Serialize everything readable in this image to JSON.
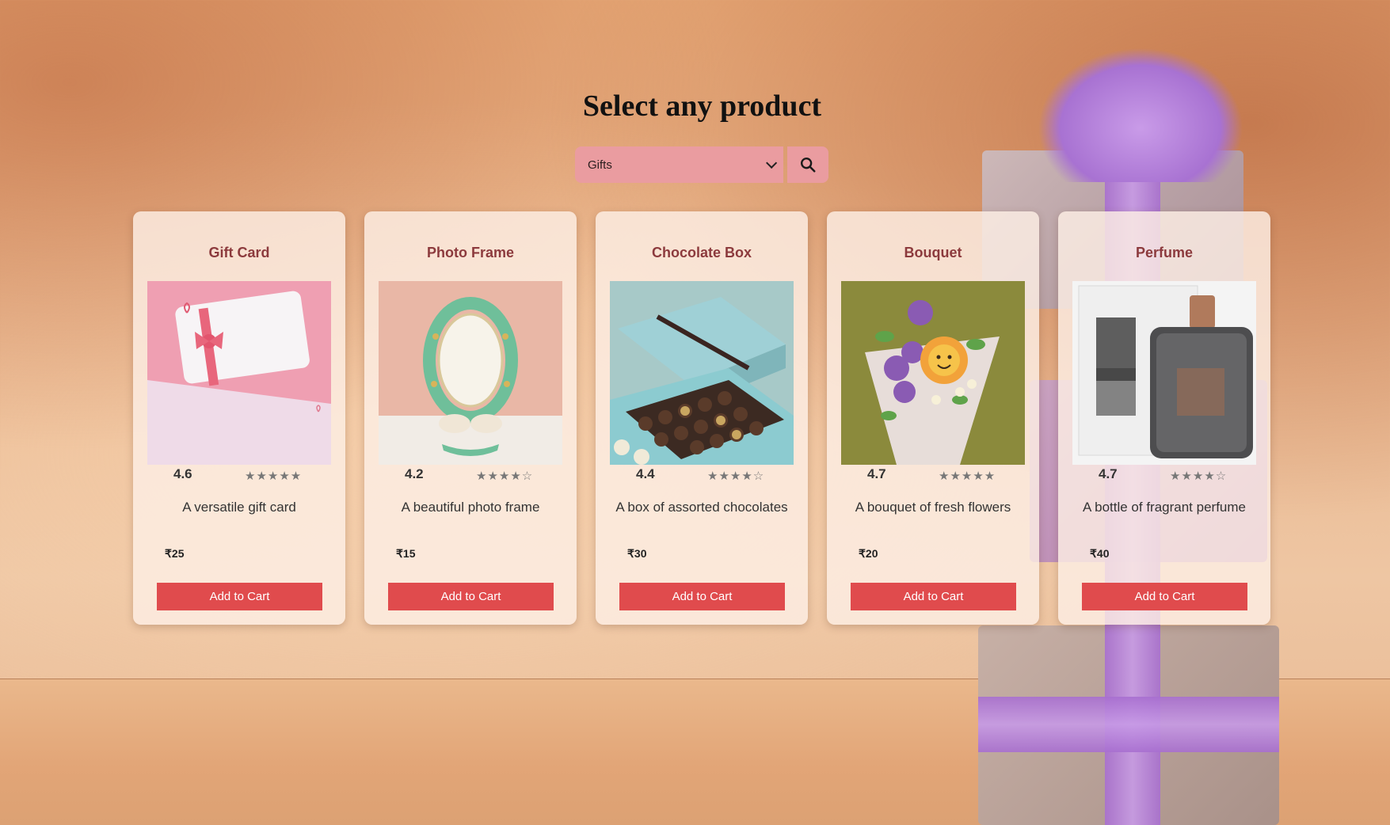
{
  "page": {
    "title": "Select any product"
  },
  "search": {
    "selected_category": "Gifts"
  },
  "colors": {
    "button": "#e04b4d",
    "name_text": "#8c3a3d",
    "select_bg": "#ea9ca0"
  },
  "products": [
    {
      "name": "Gift Card",
      "rating": "4.6",
      "rating_value": 4.6,
      "stars": "★★★★★",
      "description": "A versatile gift card",
      "price": "₹25",
      "button_label": "Add to Cart",
      "image": "gift-card-image"
    },
    {
      "name": "Photo Frame",
      "rating": "4.2",
      "rating_value": 4.2,
      "stars": "★★★★☆",
      "description": "A beautiful photo frame",
      "price": "₹15",
      "button_label": "Add to Cart",
      "image": "photo-frame-image"
    },
    {
      "name": "Chocolate Box",
      "rating": "4.4",
      "rating_value": 4.4,
      "stars": "★★★★☆",
      "description": "A box of assorted chocolates",
      "price": "₹30",
      "button_label": "Add to Cart",
      "image": "chocolate-box-image"
    },
    {
      "name": "Bouquet",
      "rating": "4.7",
      "rating_value": 4.7,
      "stars": "★★★★★",
      "description": "A bouquet of fresh flowers",
      "price": "₹20",
      "button_label": "Add to Cart",
      "image": "bouquet-image"
    },
    {
      "name": "Perfume",
      "rating": "4.7",
      "rating_value": 4.7,
      "stars": "★★★★☆",
      "description": "A bottle of fragrant perfume",
      "price": "₹40",
      "button_label": "Add to Cart",
      "image": "perfume-image"
    }
  ]
}
